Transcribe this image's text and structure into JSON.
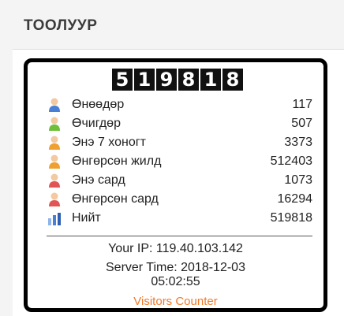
{
  "header": {
    "title": "ТООЛУУР"
  },
  "counter": {
    "digits": [
      "5",
      "1",
      "9",
      "8",
      "1",
      "8"
    ],
    "stats": [
      {
        "label": "Өнөөдөр",
        "value": "117",
        "icon": "user-blue-icon",
        "color": "#4a7fd6"
      },
      {
        "label": "Өчигдөр",
        "value": "507",
        "icon": "user-green-icon",
        "color": "#6fbf3a"
      },
      {
        "label": "Энэ 7 хоногт",
        "value": "3373",
        "icon": "user-orange-icon",
        "color": "#f0a030"
      },
      {
        "label": "Өнгөрсөн жилд",
        "value": "512403",
        "icon": "user-orange-icon",
        "color": "#f0a030"
      },
      {
        "label": "Энэ сард",
        "value": "1073",
        "icon": "user-red-icon",
        "color": "#e25555"
      },
      {
        "label": "Өнгөрсөн сард",
        "value": "16294",
        "icon": "user-red-icon",
        "color": "#e25555"
      },
      {
        "label": "Нийт",
        "value": "519818",
        "icon": "bar-chart-icon",
        "color": "#4a7fd6"
      }
    ],
    "ip_text": "Your IP: 119.40.103.142",
    "server_time_line1": "Server Time: 2018-12-03",
    "server_time_line2": "05:02:55",
    "link_text": "Visitors Counter"
  }
}
